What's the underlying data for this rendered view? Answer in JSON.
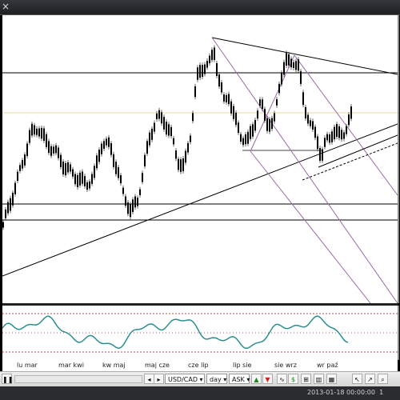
{
  "window": {
    "close_glyph": "×"
  },
  "chart": {
    "symbol": "USD/CAD",
    "timeframe": "day",
    "price_type": "ASK",
    "candle_color": "#000000",
    "trendline_color": "#000000",
    "channel_color": "#9b6aa8",
    "horizontal_level_color": "#000000",
    "highlight_level_color": "#e6d9a8"
  },
  "time_axis": {
    "labels": [
      "lu mar",
      "mar kwi",
      "kw maj",
      "maj cze",
      "cze lip",
      "lip sie",
      "sie wrz",
      "wr paź"
    ]
  },
  "oscillator": {
    "line_color": "#2a8f8f",
    "level_color": "#c84a4a"
  },
  "toolbar": {
    "symbol_label": "USD/CAD",
    "timeframe_label": "day",
    "price_label": "ASK",
    "icons": [
      "pause-icon",
      "prev-icon",
      "next-icon",
      "up-arrow-icon",
      "down-arrow-icon",
      "indicator-icon",
      "dollar-icon",
      "chart-type-icon",
      "bar-chart-icon",
      "grid-icon",
      "cursor-icon",
      "draw-tool-icon",
      "zoom-icon"
    ]
  },
  "status": {
    "datetime": "2013-01-18 00:00:00",
    "trailing": "1"
  }
}
